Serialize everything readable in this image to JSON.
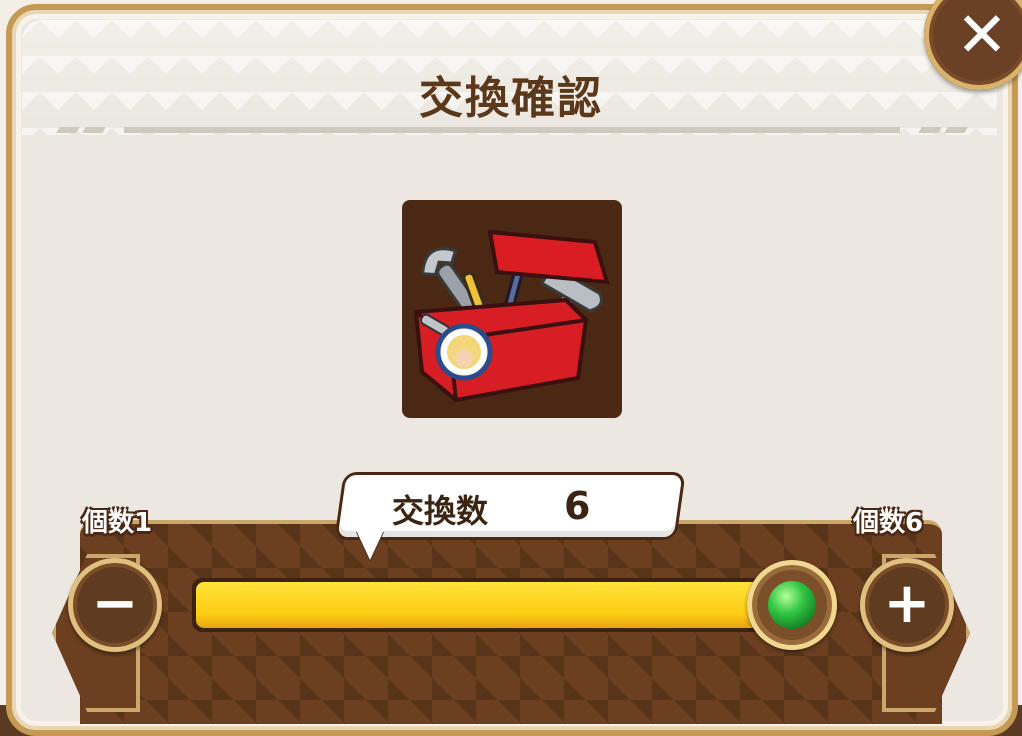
{
  "dialog": {
    "title": "交換確認",
    "close_icon": "close-icon"
  },
  "item": {
    "icon": "toolbox-icon"
  },
  "exchange": {
    "label": "交換数",
    "quantity": "6",
    "min_label": "個数1",
    "max_label": "個数6",
    "min": 1,
    "max": 6,
    "value": 6
  },
  "buttons": {
    "minus": "−",
    "plus": "+",
    "close": "✕"
  },
  "colors": {
    "accent_gold": "#c59a54",
    "slider_fill": "#ffcc14",
    "knob_gem": "#33c743",
    "panel_brown": "#6b3f1f"
  }
}
